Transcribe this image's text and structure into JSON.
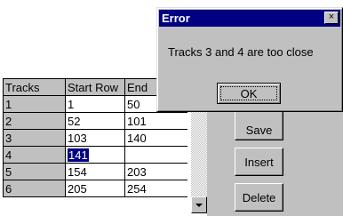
{
  "dialog": {
    "title": "Error",
    "close_label": "×",
    "message": "Tracks 3 and 4 are too close",
    "ok_label": "OK"
  },
  "grid": {
    "columns": [
      "Tracks",
      "Start Row",
      "End"
    ],
    "rows": [
      {
        "track": "1",
        "start": "1",
        "end": "50"
      },
      {
        "track": "2",
        "start": "52",
        "end": "101"
      },
      {
        "track": "3",
        "start": "103",
        "end": "140"
      },
      {
        "track": "4",
        "start": "141",
        "end": ""
      },
      {
        "track": "5",
        "start": "154",
        "end": "203"
      },
      {
        "track": "6",
        "start": "205",
        "end": "254"
      }
    ]
  },
  "buttons": {
    "save": "Save",
    "insert": "Insert",
    "delete": "Delete"
  }
}
